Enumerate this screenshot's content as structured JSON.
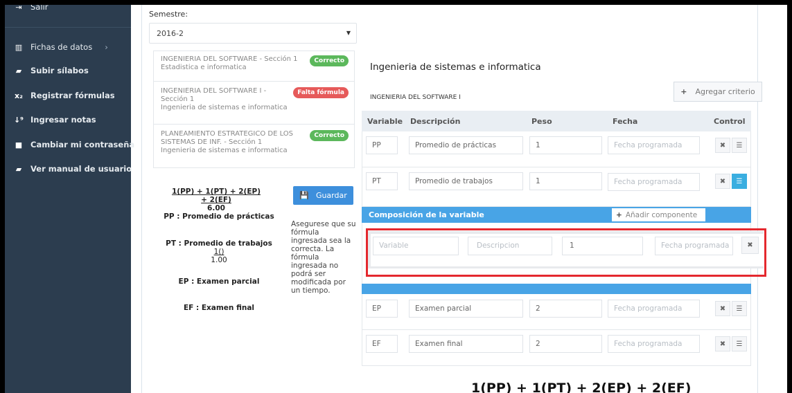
{
  "sidebar": {
    "items": [
      {
        "label": "Salir",
        "icon": "logout-icon",
        "glyph": "⇥"
      },
      {
        "label": "Fichas de datos",
        "icon": "bar-chart-icon",
        "glyph": "▥",
        "chevron": "›"
      },
      {
        "label": "Subir sílabos",
        "icon": "book-icon",
        "glyph": "▰"
      },
      {
        "label": "Registrar fórmulas",
        "icon": "subscript-icon",
        "glyph": "x₂"
      },
      {
        "label": "Ingresar notas",
        "icon": "sort-numeric-icon",
        "glyph": "↓⁹"
      },
      {
        "label": "Cambiar mi contraseña",
        "icon": "lock-icon",
        "glyph": "🔒"
      },
      {
        "label": "Ver manual de usuario",
        "icon": "book-icon",
        "glyph": "▰"
      }
    ]
  },
  "semester": {
    "label": "Semestre:",
    "value": "2016-2"
  },
  "courses": [
    {
      "name": "INGENIERIA DEL SOFTWARE - Sección 1",
      "sub": "Estadistica e informatica",
      "badge": "Correcto",
      "status": "ok"
    },
    {
      "name": "INGENIERIA DEL SOFTWARE I -",
      "name2": "Sección 1",
      "sub": "Ingenieria de sistemas e informatica",
      "badge": "Falta fórmula",
      "status": "bad"
    },
    {
      "name": "PLANEAMIENTO ESTRATEGICO DE LOS",
      "name2": "SISTEMAS DE INF. - Sección 1",
      "sub": "Ingenieria de sistemas e informatica",
      "badge": "Correcto",
      "status": "ok"
    }
  ],
  "formula": {
    "expression": "1(PP) + 1(PT) + 2(EP) + 2(EF)",
    "result": "6.00",
    "save_label": "Guardar"
  },
  "variables_legend": [
    {
      "text": "PP : Promedio de prácticas"
    },
    {
      "text": "PT : Promedio de trabajos",
      "sub_formula": "1()",
      "sub_result": "1.00"
    },
    {
      "text": "EP : Examen parcial"
    },
    {
      "text": "EF : Examen final"
    }
  ],
  "note": "Asegurese que su fórmula ingresada sea la correcta. La fórmula ingresada no podrá ser modificada por un tiempo.",
  "panel": {
    "title": "Ingenieria de sistemas e informatica",
    "course": "INGENIERIA DEL SOFTWARE I",
    "add_criterion": "Agregar criterio"
  },
  "table": {
    "headers": {
      "variable": "Variable",
      "description": "Descripción",
      "weight": "Peso",
      "date": "Fecha",
      "control": "Control"
    },
    "rows": [
      {
        "variable": "PP",
        "description": "Promedio de prácticas",
        "weight": "1",
        "date_placeholder": "Fecha programada"
      },
      {
        "variable": "PT",
        "description": "Promedio de trabajos",
        "weight": "1",
        "date_placeholder": "Fecha programada"
      },
      {
        "variable": "EP",
        "description": "Examen parcial",
        "weight": "2",
        "date_placeholder": "Fecha programada"
      },
      {
        "variable": "EF",
        "description": "Examen final",
        "weight": "2",
        "date_placeholder": "Fecha programada"
      }
    ]
  },
  "composition": {
    "title": "Composición de la variable",
    "add_component": "Añadir componente",
    "row": {
      "variable_placeholder": "Variable",
      "description_placeholder": "Descripcion",
      "weight": "1",
      "date_placeholder": "Fecha programada"
    }
  },
  "bottom_formula": "1(PP) + 1(PT) + 2(EP) + 2(EF)",
  "colors": {
    "sidebar": "#2c3d4f",
    "accent": "#48a4e6",
    "ok": "#5cb85c",
    "error": "#e65a5a",
    "highlight": "#e4282e"
  }
}
